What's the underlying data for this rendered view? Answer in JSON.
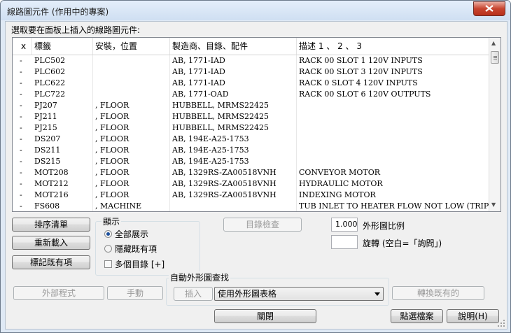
{
  "window": {
    "title": "線路圖元件 (作用中的專案)"
  },
  "prompt": "選取要在面板上插入的線路圖元件:",
  "table": {
    "headers": [
      "x",
      "標籤",
      "安裝，位置",
      "製造商、目錄、配件",
      "描述 1 、 2 、 3"
    ],
    "rows": [
      [
        "-",
        "PLC502",
        "",
        "AB, 1771-IAD",
        "RACK 00 SLOT 1 120V INPUTS"
      ],
      [
        "-",
        "PLC602",
        "",
        "AB, 1771-IAD",
        "RACK 00 SLOT 3 120V INPUTS"
      ],
      [
        "-",
        "PLC622",
        "",
        "AB, 1771-IAD",
        "RACK 0 SLOT 4 120V INPUTS"
      ],
      [
        "-",
        "PLC722",
        "",
        "AB, 1771-OAD",
        "RACK 00 SLOT 6 120V OUTPUTS"
      ],
      [
        "-",
        "PJ207",
        ", FLOOR",
        "HUBBELL, MRMS22425",
        ""
      ],
      [
        "-",
        "PJ211",
        ", FLOOR",
        "HUBBELL, MRMS22425",
        ""
      ],
      [
        "-",
        "PJ215",
        ", FLOOR",
        "HUBBELL, MRMS22425",
        ""
      ],
      [
        "-",
        "DS207",
        ", FLOOR",
        "AB, 194E-A25-1753",
        ""
      ],
      [
        "-",
        "DS211",
        ", FLOOR",
        "AB, 194E-A25-1753",
        ""
      ],
      [
        "-",
        "DS215",
        ", FLOOR",
        "AB, 194E-A25-1753",
        ""
      ],
      [
        "-",
        "MOT208",
        ", FLOOR",
        "AB, 1329RS-ZA00518VNH",
        "CONVEYOR MOTOR"
      ],
      [
        "-",
        "MOT212",
        ", FLOOR",
        "AB, 1329RS-ZA00518VNH",
        "HYDRAULIC MOTOR"
      ],
      [
        "-",
        "MOT216",
        ", FLOOR",
        "AB, 1329RS-ZA00518VNH",
        "INDEXING MOTOR"
      ],
      [
        "-",
        "FS608",
        ", MACHINE",
        "",
        "TUB INLET TO HEATER FLOW NOT LOW (TRIP)"
      ]
    ]
  },
  "buttons": {
    "sort": "排序清單",
    "reload": "重新載入",
    "mark_existing": "標記既有項",
    "catalog_check": "目錄檢查",
    "external": "外部程式",
    "manual": "手動",
    "insert": "插入",
    "convert_existing": "轉換既有的",
    "close": "關閉",
    "pick_file": "點選檔案",
    "help": "說明(H)"
  },
  "display_group": {
    "label": "顯示",
    "show_all": "全部展示",
    "hide_existing": "隱藏既有項",
    "multi_catalog": "多個目錄 [+]",
    "selected": "show_all",
    "multi_catalog_checked": false
  },
  "scale": {
    "value": "1.000",
    "label": "外形圖比例"
  },
  "rotate": {
    "value": "",
    "label": "旋轉 (空白=「詢問」)"
  },
  "footprint_group": {
    "label": "自動外形圖查找",
    "combo_value": "使用外形圖表格"
  }
}
